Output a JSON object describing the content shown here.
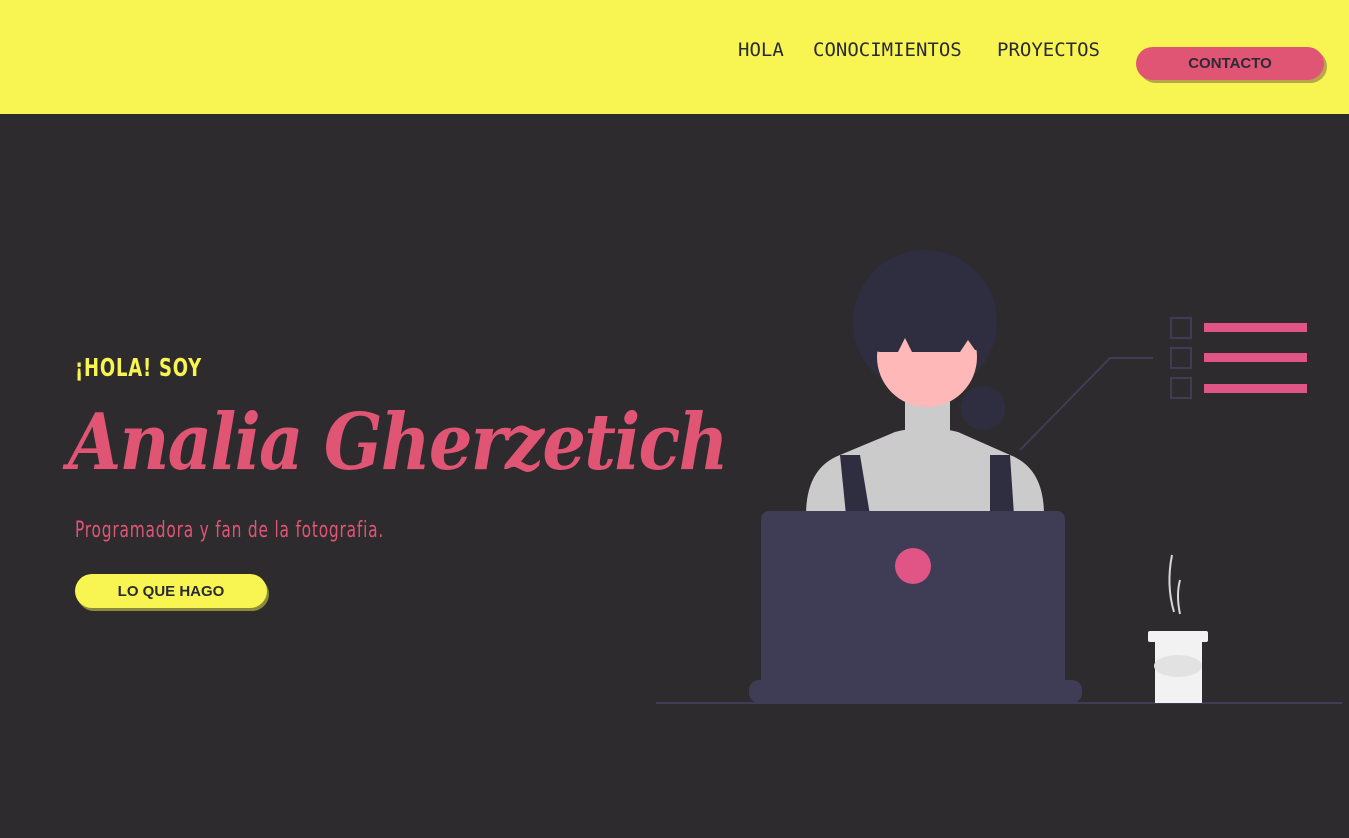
{
  "nav": {
    "links": [
      "HOLA",
      "CONOCIMIENTOS",
      "PROYECTOS"
    ],
    "contact_label": "CONTACTO"
  },
  "hero": {
    "greeting": "¡HOLA! SOY",
    "name": "Analia Gherzetich",
    "subtitle": "Programadora y fan de la fotografia.",
    "cta_label": "LO QUE HAGO"
  },
  "colors": {
    "header_bg": "#f8f552",
    "page_bg": "#2d2b2d",
    "accent_pink": "#e05574",
    "accent_yellow": "#f8f552"
  },
  "icons": [
    "woman-at-laptop-illustration",
    "checklist-icon",
    "coffee-cup-icon"
  ]
}
